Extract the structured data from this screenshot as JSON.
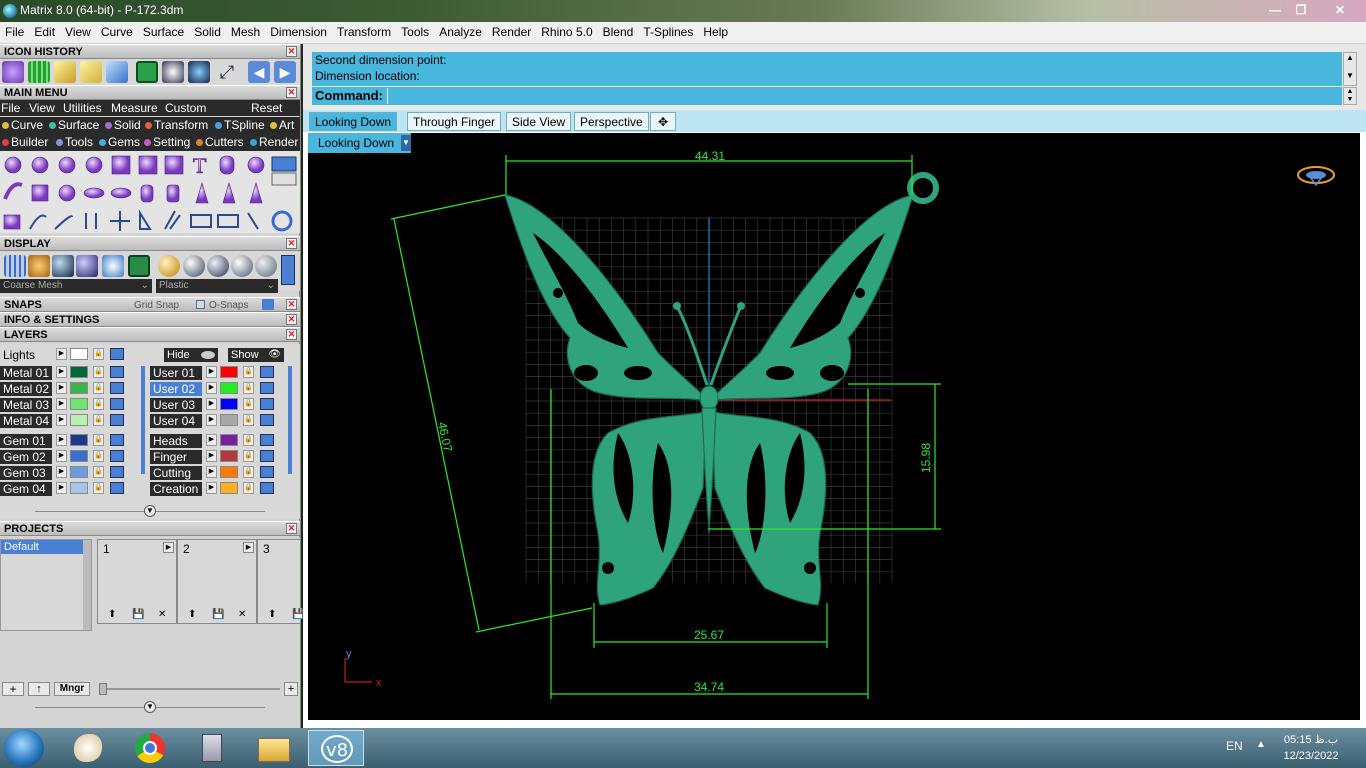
{
  "window": {
    "title": "Matrix 8.0 (64-bit) - P-172.3dm"
  },
  "menubar": [
    "File",
    "Edit",
    "View",
    "Curve",
    "Surface",
    "Solid",
    "Mesh",
    "Dimension",
    "Transform",
    "Tools",
    "Analyze",
    "Render",
    "Rhino 5.0",
    "Blend",
    "T-Splines",
    "Help"
  ],
  "panels": {
    "icon_history": "ICON HISTORY",
    "main_menu": "MAIN MENU",
    "display": "DISPLAY",
    "snaps": "SNAPS",
    "info": "INFO & SETTINGS",
    "layers": "LAYERS",
    "projects": "PROJECTS"
  },
  "main_menu": {
    "items": [
      "File",
      "View",
      "Utilities",
      "Measure",
      "Custom"
    ],
    "reset": "Reset",
    "row1": [
      {
        "label": "Curve",
        "color": "#d8c040"
      },
      {
        "label": "Surface",
        "color": "#40c0a0"
      },
      {
        "label": "Solid",
        "color": "#a070d0"
      },
      {
        "label": "Transform",
        "color": "#e06040"
      },
      {
        "label": "TSpline",
        "color": "#50a0e0"
      },
      {
        "label": "Art",
        "color": "#e0c040"
      }
    ],
    "row2": [
      {
        "label": "Builder",
        "color": "#e04040"
      },
      {
        "label": "Tools",
        "color": "#9090e0"
      },
      {
        "label": "Gems",
        "color": "#40b0e0"
      },
      {
        "label": "Setting",
        "color": "#c060c0"
      },
      {
        "label": "Cutters",
        "color": "#e08030"
      },
      {
        "label": "Render",
        "color": "#40a0d0"
      }
    ]
  },
  "display": {
    "mesh": "Coarse Mesh",
    "material": "Plastic"
  },
  "snaps": {
    "grid": "Grid Snap",
    "osnaps": "O-Snaps"
  },
  "layers": {
    "lights": {
      "name": "Lights",
      "color": "#ffffff"
    },
    "hide": "Hide",
    "show": "Show",
    "left": [
      {
        "name": "Metal 01",
        "color": "#006837"
      },
      {
        "name": "Metal 02",
        "color": "#3ab54a"
      },
      {
        "name": "Metal 03",
        "color": "#6ee66e"
      },
      {
        "name": "Metal 04",
        "color": "#b8f0b0"
      },
      {
        "name": "Gem 01",
        "color": "#1d3a8a"
      },
      {
        "name": "Gem 02",
        "color": "#3c6ed0"
      },
      {
        "name": "Gem 03",
        "color": "#6c9ae0"
      },
      {
        "name": "Gem 04",
        "color": "#a8c4ec"
      }
    ],
    "right": [
      {
        "name": "User 01",
        "color": "#ff0000"
      },
      {
        "name": "User 02",
        "color": "#22ee22"
      },
      {
        "name": "User 03",
        "color": "#0000ff"
      },
      {
        "name": "User 04",
        "color": "#a8a8a8"
      },
      {
        "name": "Heads",
        "color": "#7a1ea0"
      },
      {
        "name": "Finger",
        "color": "#b03a3a"
      },
      {
        "name": "Cutting",
        "color": "#ff7a00"
      },
      {
        "name": "Creation",
        "color": "#ffb020"
      }
    ],
    "selected": "User 02"
  },
  "projects": {
    "list": [
      "Default"
    ],
    "slots": [
      "1",
      "2",
      "3"
    ],
    "mngr": "Mngr"
  },
  "command": {
    "history": [
      "Second dimension point:",
      "Dimension location:"
    ],
    "prompt": "Command:"
  },
  "viewport_tabs": [
    "Looking Down",
    "Through Finger",
    "Side View",
    "Perspective"
  ],
  "active_tab": "Looking Down",
  "viewport_select": "Looking Down",
  "dimensions": {
    "top": "44.31",
    "left": "46.07",
    "right": "15.98",
    "bottom_inner": "25.67",
    "bottom_outer": "34.74"
  },
  "axes": {
    "x": "x",
    "y": "y"
  },
  "colors": {
    "model": "#2fa47c",
    "dim": "#2ee82e",
    "accent": "#49b7dd"
  },
  "taskbar": {
    "lang": "EN",
    "time": "05:15 ب.ظ",
    "date": "12/23/2022"
  }
}
